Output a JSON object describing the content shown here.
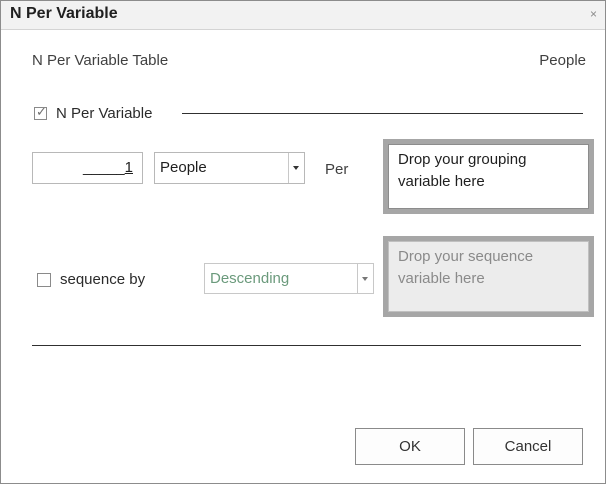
{
  "window": {
    "title": "N Per Variable",
    "close_glyph": "×"
  },
  "header": {
    "table_label": "N Per Variable Table",
    "target_label": "People"
  },
  "n_per_variable": {
    "label": "N Per Variable",
    "checked": true,
    "count_value": "1",
    "unit_selected": "People",
    "per_label": "Per",
    "grouping_drop_text": "Drop your grouping variable here"
  },
  "sequence": {
    "label": "sequence by",
    "checked": false,
    "order_selected": "Descending",
    "sequence_drop_text": "Drop your sequence variable here"
  },
  "buttons": {
    "ok": "OK",
    "cancel": "Cancel"
  },
  "icons": {
    "checked_box": "check-icon",
    "dropdown": "chevron-down-icon",
    "close": "close-icon"
  },
  "colors": {
    "disabled_text": "#6b9a7c",
    "drop_zone_border": "#a6a6a6",
    "disabled_zone_bg": "#ececec"
  }
}
